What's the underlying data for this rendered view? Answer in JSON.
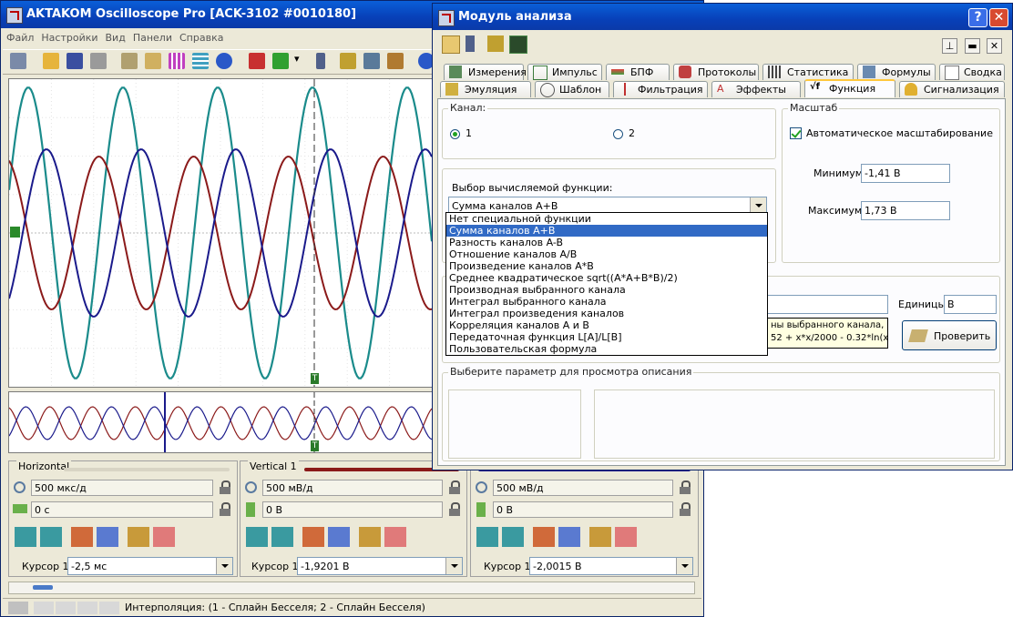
{
  "main_window": {
    "title": "AKTAKOM Oscilloscope Pro [ACK-3102 #0010180]",
    "menu": [
      "Файл",
      "Настройки",
      "Вид",
      "Панели",
      "Справка"
    ],
    "cursor_marker": "T",
    "panels": {
      "horizontal": {
        "title": "Horizontal",
        "scale": "500 мкс/д",
        "offset": "0 с",
        "cursor_label": "Курсор 1",
        "cursor_value": "-2,5 мс"
      },
      "vertical1": {
        "title": "Vertical 1",
        "scale": "500 мВ/д",
        "offset": "0 В",
        "cursor_label": "Курсор 1",
        "cursor_value": "-1,9201 В",
        "color": "#8b1a1a"
      },
      "vertical2": {
        "scale": "500 мВ/д",
        "offset": "0 В",
        "cursor_label": "Курсор 1",
        "cursor_value": "-2,0015 В",
        "color": "#1a1a8b"
      }
    },
    "status_text": "Интерполяция: (1 - Сплайн Бесселя; 2 - Сплайн Бесселя)",
    "colors": {
      "channel_a": "#8b1a1a",
      "channel_b": "#1a1a8b",
      "math": "#1a8b8b"
    }
  },
  "dialog": {
    "title": "Модуль анализа",
    "help_btn": "?",
    "close_btn": "✕",
    "tabs_row1": [
      "Измерения",
      "Импульс",
      "БПФ",
      "Протоколы",
      "Статистика",
      "Формулы",
      "Сводка"
    ],
    "tabs_row2": [
      "Эмуляция",
      "Шаблон",
      "Фильтрация",
      "Эффекты",
      "Функция",
      "Сигнализация"
    ],
    "active_tab": "Функция",
    "channel_group": {
      "label": "Канал:",
      "option1": "1",
      "option2": "2",
      "selected": "1"
    },
    "function_group": {
      "label": "Выбор вычисляемой функции:",
      "selected": "Сумма каналов A+B",
      "options": [
        "Нет специальной функции",
        "Сумма каналов A+B",
        "Разность каналов A-B",
        "Отношение каналов A/B",
        "Произведение каналов A*B",
        "Среднее квадратическое sqrt((A*A+B*B)/2)",
        "Производная выбранного канала",
        "Интеграл выбранного канала",
        "Интеграл произведения каналов",
        "Корреляция каналов А и В",
        "Передаточная функция L[A]/L[B]",
        "Пользовательская формула"
      ]
    },
    "scale_group": {
      "label": "Масштаб",
      "auto_scale_label": "Автоматическое масштабирование",
      "auto_scale_checked": true,
      "min_label": "Минимум",
      "min_value": "-1,41 В",
      "max_label": "Максимум",
      "max_value": "1,73 В"
    },
    "formula": {
      "units_label": "Единицы:",
      "units_value": "В",
      "hint_line1": "ны выбранного канала,",
      "hint_line2": "52 + x*x/2000 - 0.32*ln(x)",
      "check_button": "Проверить"
    },
    "description_group": {
      "label": "Выберите параметр для просмотра описания"
    }
  }
}
